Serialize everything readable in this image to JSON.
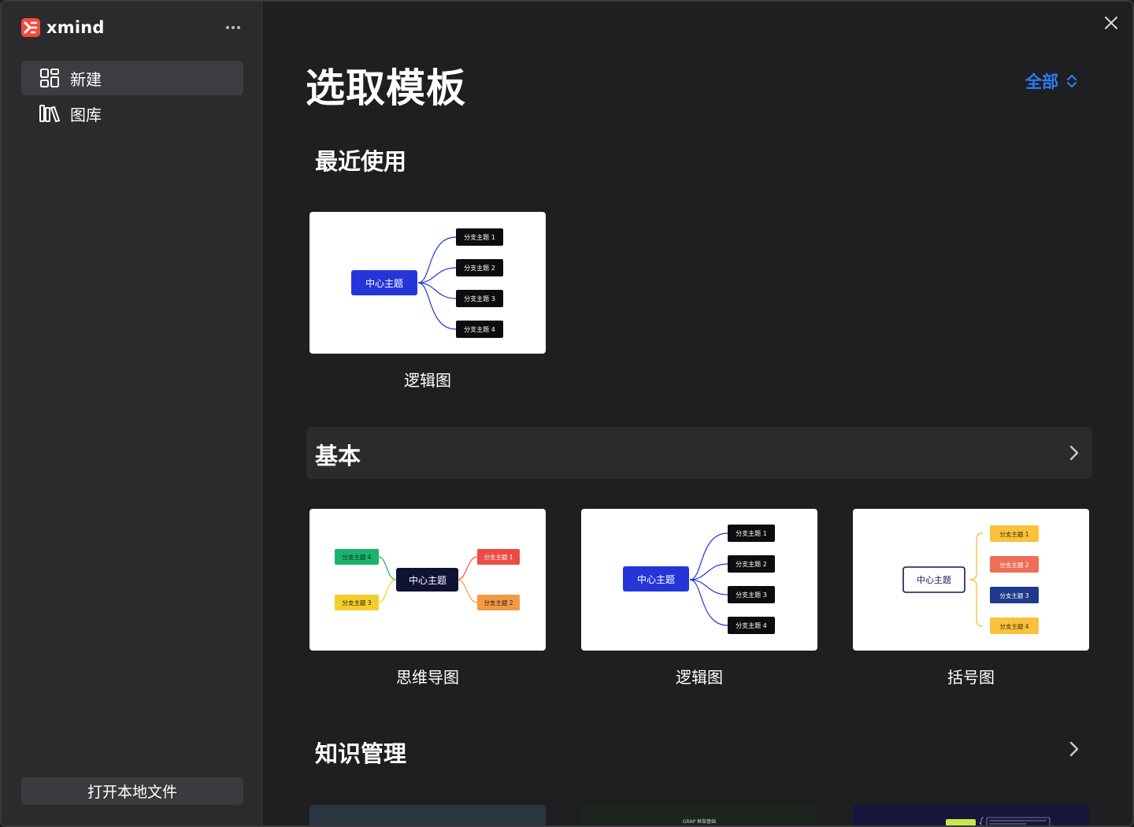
{
  "app": {
    "name": "xmind"
  },
  "sidebar": {
    "items": [
      {
        "label": "新建",
        "icon": "grid-icon",
        "active": true
      },
      {
        "label": "图库",
        "icon": "library-icon",
        "active": false
      }
    ],
    "open_local_label": "打开本地文件"
  },
  "main": {
    "title": "选取模板",
    "filter_label": "全部",
    "recent": {
      "title": "最近使用",
      "cards": [
        {
          "label": "逻辑图"
        }
      ]
    },
    "basic": {
      "title": "基本",
      "cards": [
        {
          "label": "思维导图"
        },
        {
          "label": "逻辑图"
        },
        {
          "label": "括号图"
        }
      ]
    },
    "knowledge": {
      "title": "知识管理",
      "preview_texts": [
        "GRAP 框架基础"
      ]
    }
  },
  "templates": {
    "center_topic": "中心主题",
    "branch_1": "分支主题 1",
    "branch_2": "分支主题 2",
    "branch_3": "分支主题 3",
    "branch_4": "分支主题 4"
  },
  "colors": {
    "accent": "#2f7bf6",
    "logic_center": "#2536d9",
    "branch_dark": "#0d0d0d",
    "mindmap_center": "#0f1233",
    "mindmap_red": "#ee4b47",
    "mindmap_orange": "#f59a44",
    "mindmap_green": "#19b36b",
    "mindmap_yellow": "#f5cd2c",
    "bracket_yellow": "#fbc13c",
    "bracket_coral": "#ef6e57",
    "bracket_navy": "#1f3a8a"
  }
}
